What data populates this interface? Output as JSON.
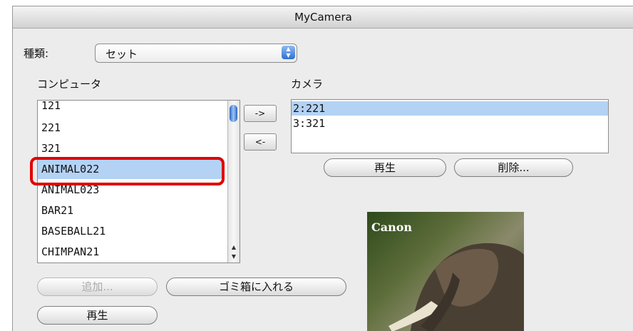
{
  "window": {
    "title": "MyCamera"
  },
  "type_selector": {
    "label": "種類:",
    "value": "セット"
  },
  "computer_list": {
    "heading": "コンピュータ",
    "items": [
      "121",
      "221",
      "321",
      "ANIMAL022",
      "ANIMAL023",
      "BAR21",
      "BASEBALL21",
      "CHIMPAN21"
    ],
    "selected_index": 3
  },
  "transfer": {
    "to_camera": "->",
    "to_computer": "<-"
  },
  "camera_list": {
    "heading": "カメラ",
    "items": [
      "2:221",
      "3:321"
    ],
    "selected_index": 0
  },
  "camera_buttons": {
    "play": "再生",
    "delete": "削除..."
  },
  "computer_buttons": {
    "add": "追加...",
    "trash": "ゴミ箱に入れる",
    "play": "再生"
  },
  "preview": {
    "brand": "Canon"
  },
  "colors": {
    "selection": "#b4d2f4",
    "highlight_box": "#e00000"
  }
}
